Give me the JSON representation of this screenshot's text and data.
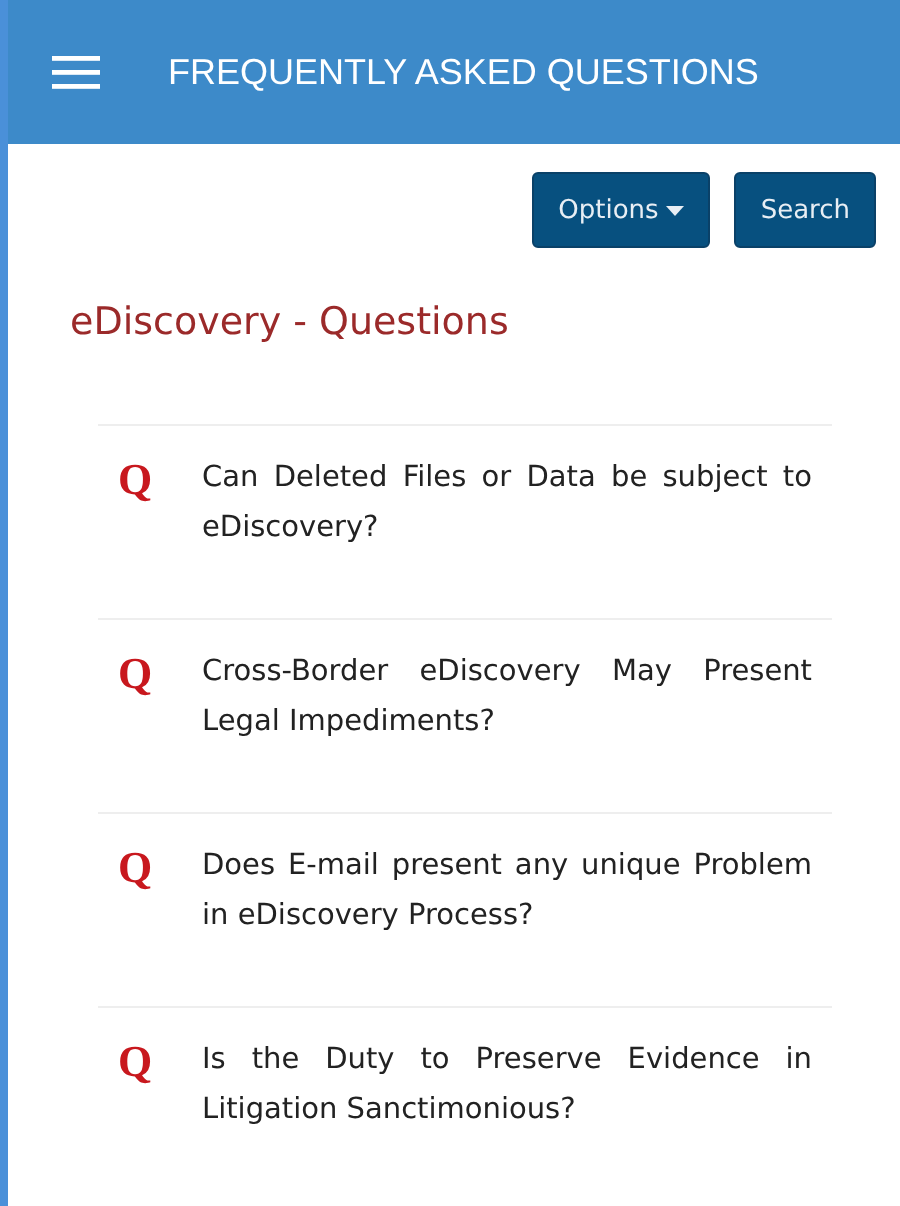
{
  "header": {
    "title": "FREQUENTLY ASKED QUESTIONS"
  },
  "toolbar": {
    "buttons": [
      {
        "label": "Options",
        "kind": "dropdown"
      },
      {
        "label": "Search",
        "kind": "plain"
      }
    ]
  },
  "section_title": "eDiscovery - Questions",
  "questions": [
    {
      "marker": "Q",
      "text": "Can Deleted Files or Data be subject to eDiscovery?"
    },
    {
      "marker": "Q",
      "text": "Cross-Border eDiscovery May Present Legal Impediments?"
    },
    {
      "marker": "Q",
      "text": "Does E-mail present any unique Problem in eDiscovery Process?"
    },
    {
      "marker": "Q",
      "text": "Is the Duty to Preserve Evidence in Litigation Sanctimonious?"
    }
  ]
}
